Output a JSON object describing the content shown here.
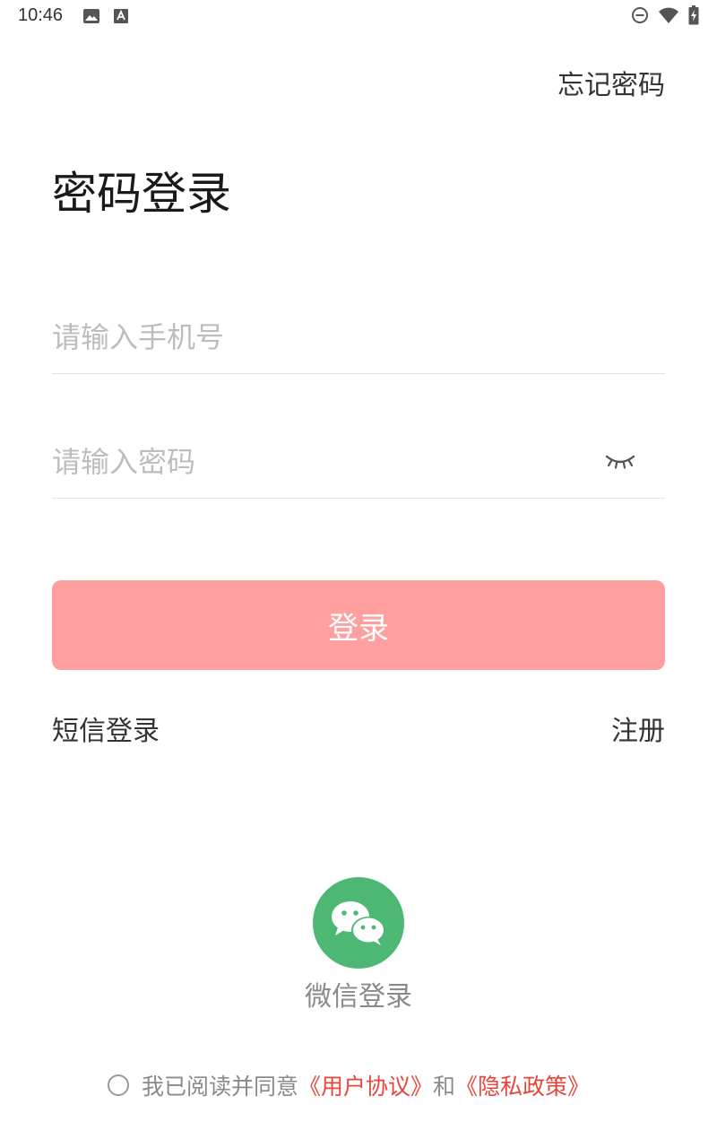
{
  "status_bar": {
    "time": "10:46",
    "icons": [
      "image-icon",
      "keyboard-a-icon",
      "dnd-icon",
      "wifi-icon",
      "battery-charging-icon"
    ]
  },
  "header": {
    "forgot_password": "忘记密码",
    "title": "密码登录"
  },
  "form": {
    "phone_placeholder": "请输入手机号",
    "phone_value": "",
    "password_placeholder": "请输入密码",
    "password_value": "",
    "password_toggle_icon": "eye-closed-icon",
    "login_button": "登录"
  },
  "links": {
    "sms_login": "短信登录",
    "register": "注册"
  },
  "social": {
    "wechat_label": "微信登录",
    "wechat_icon": "wechat-icon",
    "wechat_color": "#4cb874"
  },
  "agreement": {
    "checked": false,
    "prefix": "我已阅读并同意",
    "user_agreement": "《用户协议》",
    "and": "和",
    "privacy_policy": "《隐私政策》"
  },
  "colors": {
    "login_button_bg": "#ff9f9f",
    "link_red": "#e8453c",
    "placeholder": "#bdbdbd"
  }
}
